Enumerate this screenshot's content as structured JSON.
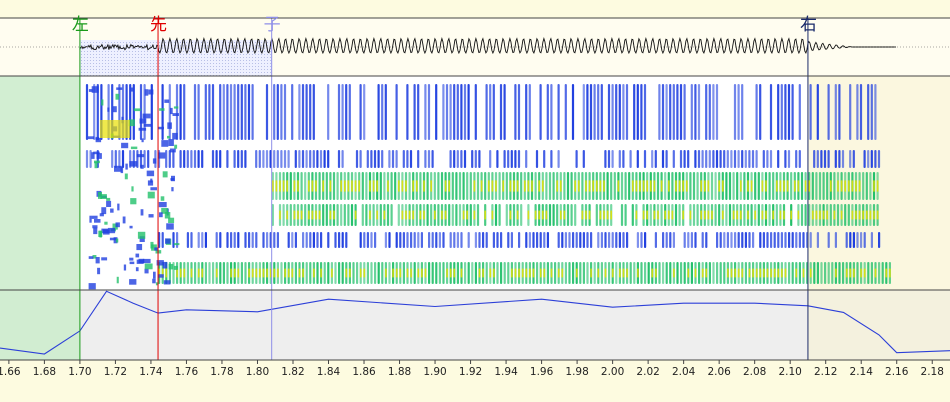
{
  "markers": [
    {
      "id": "left-boundary",
      "label": "左",
      "time": 1.7,
      "color": "#1a9a1a"
    },
    {
      "id": "onset",
      "label": "先",
      "time": 1.744,
      "color": "#e00000"
    },
    {
      "id": "consonant-end",
      "label": "子",
      "time": 1.808,
      "color": "#8f8fe8"
    },
    {
      "id": "right-boundary",
      "label": "右",
      "time": 2.11,
      "color": "#1a2a6a"
    }
  ],
  "axis": {
    "start": 1.655,
    "end": 2.19,
    "ticks": [
      "1.66",
      "1.68",
      "1.70",
      "1.72",
      "1.74",
      "1.76",
      "1.78",
      "1.80",
      "1.82",
      "1.84",
      "1.86",
      "1.88",
      "1.90",
      "1.92",
      "1.94",
      "1.96",
      "1.98",
      "2.00",
      "2.02",
      "2.04",
      "2.06",
      "2.08",
      "2.10",
      "2.12",
      "2.14",
      "2.16",
      "2.18"
    ]
  },
  "pitch_contour": {
    "times": [
      1.655,
      1.68,
      1.7,
      1.715,
      1.73,
      1.744,
      1.76,
      1.8,
      1.84,
      1.9,
      1.96,
      2.0,
      2.04,
      2.08,
      2.11,
      2.13,
      2.15,
      2.16,
      2.19
    ],
    "levels": [
      0.12,
      0.03,
      0.38,
      0.98,
      0.8,
      0.65,
      0.7,
      0.67,
      0.86,
      0.75,
      0.86,
      0.74,
      0.8,
      0.8,
      0.76,
      0.66,
      0.32,
      0.05,
      0.08
    ]
  },
  "colors": {
    "background": "#fdfbe0",
    "selection_tint": "#cdeccd",
    "waveform": "#111111",
    "pitch_line": "#2c3fd8",
    "spectrogram_high": "#e8e000",
    "spectrogram_mid": "#22c06a",
    "spectrogram_low": "#1f3fe0"
  }
}
